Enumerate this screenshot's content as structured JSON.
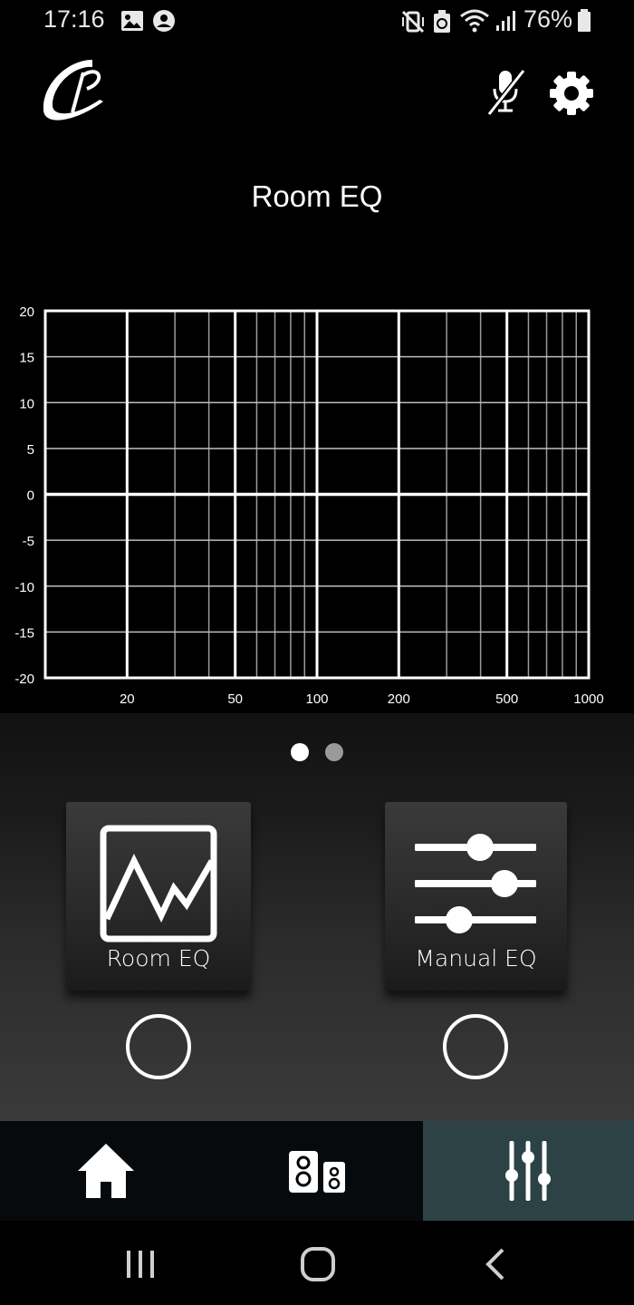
{
  "status_bar": {
    "time": "17:16",
    "battery": "76%"
  },
  "header": {
    "logo_icon": "brand-logo",
    "mic_icon": "microphone-muted-icon",
    "settings_icon": "gear-icon"
  },
  "page": {
    "title": "Room EQ"
  },
  "chart_data": {
    "type": "line",
    "x_scale": "log",
    "xlim": [
      10,
      1000
    ],
    "ylim": [
      -20,
      20
    ],
    "x_tick_labels": [
      "20",
      "50",
      "100",
      "200",
      "500",
      "1000"
    ],
    "y_tick_labels": [
      "20",
      "15",
      "10",
      "5",
      "0",
      "-5",
      "-10",
      "-15",
      "-20"
    ],
    "grid": true,
    "series": []
  },
  "pager": {
    "active_index": 0,
    "count": 2
  },
  "modes": {
    "room": {
      "label": "Room EQ",
      "icon": "room-eq-graph-icon",
      "selected": false
    },
    "manual": {
      "label": "Manual EQ",
      "icon": "sliders-icon",
      "selected": false
    }
  },
  "bottom_nav": {
    "items": [
      {
        "icon": "home-icon",
        "active": false
      },
      {
        "icon": "speakers-icon",
        "active": false
      },
      {
        "icon": "equalizer-icon",
        "active": true
      }
    ],
    "active_color": "#2c4244"
  },
  "system_nav": {
    "items": [
      "recent-apps-icon",
      "home-circle-icon",
      "back-icon"
    ]
  }
}
